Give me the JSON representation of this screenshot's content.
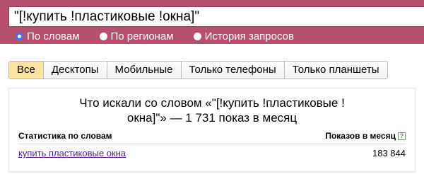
{
  "search": {
    "query": "\"[!купить !пластиковые !окна]\""
  },
  "modes": [
    {
      "label": "По словам",
      "selected": true
    },
    {
      "label": "По регионам",
      "selected": false
    },
    {
      "label": "История запросов",
      "selected": false
    }
  ],
  "tabs": [
    {
      "label": "Все",
      "active": true
    },
    {
      "label": "Десктопы",
      "active": false
    },
    {
      "label": "Мобильные",
      "active": false
    },
    {
      "label": "Только телефоны",
      "active": false
    },
    {
      "label": "Только планшеты",
      "active": false
    }
  ],
  "results": {
    "title_line1": "Что искали со словом «\"[!купить !пластиковые !",
    "title_line2": "окна]\"» — 1 731 показ в месяц",
    "col_left": "Статистика по словам",
    "col_right": "Показов в месяц",
    "help_glyph": "?",
    "rows": [
      {
        "phrase": "купить пластиковые окна",
        "count": "183 844"
      }
    ]
  },
  "colors": {
    "band": "#b5506e",
    "active_tab": "#fbe3a1",
    "visited_link": "#551a8b"
  }
}
